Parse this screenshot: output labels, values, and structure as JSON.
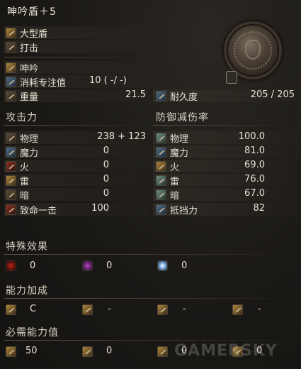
{
  "title": "呻吟盾＋5",
  "item_info": {
    "type": "大型盾",
    "attack_type": "打击",
    "skill": "呻吟",
    "fp_cost_label": "消耗专注值",
    "fp_cost_value": "10 (   -/   -)",
    "weight_label": "重量",
    "weight_value": "21.5",
    "durability_label": "耐久度",
    "durability_value": "205 /   205"
  },
  "attack": {
    "header": "攻击力",
    "rows": [
      {
        "label": "物理",
        "value": "238 +   123",
        "icon": "physical-attack-icon"
      },
      {
        "label": "魔力",
        "value": "0",
        "icon": "magic-attack-icon"
      },
      {
        "label": "火",
        "value": "0",
        "icon": "fire-attack-icon"
      },
      {
        "label": "雷",
        "value": "0",
        "icon": "lightning-attack-icon"
      },
      {
        "label": "暗",
        "value": "0",
        "icon": "dark-attack-icon"
      },
      {
        "label": "致命一击",
        "value": "100",
        "icon": "critical-icon"
      }
    ]
  },
  "defense": {
    "header": "防御减伤率",
    "rows": [
      {
        "label": "物理",
        "value": "100.0",
        "icon": "physical-defense-icon"
      },
      {
        "label": "魔力",
        "value": "81.0",
        "icon": "magic-defense-icon"
      },
      {
        "label": "火",
        "value": "69.0",
        "icon": "fire-defense-icon"
      },
      {
        "label": "雷",
        "value": "76.0",
        "icon": "lightning-defense-icon"
      },
      {
        "label": "暗",
        "value": "67.0",
        "icon": "dark-defense-icon"
      },
      {
        "label": "抵挡力",
        "value": "82",
        "icon": "stability-icon"
      }
    ]
  },
  "special_effects": {
    "header": "特殊效果",
    "items": [
      {
        "icon": "bleed-icon",
        "value": "0"
      },
      {
        "icon": "poison-icon",
        "value": "0"
      },
      {
        "icon": "frost-icon",
        "value": "0"
      }
    ]
  },
  "scaling": {
    "header": "能力加成",
    "items": [
      {
        "icon": "strength-icon",
        "value": "C"
      },
      {
        "icon": "dexterity-icon",
        "value": "-"
      },
      {
        "icon": "intelligence-icon",
        "value": "-"
      },
      {
        "icon": "faith-icon",
        "value": "-"
      }
    ]
  },
  "requirements": {
    "header": "必需能力值",
    "items": [
      {
        "icon": "strength-req-icon",
        "value": "50"
      },
      {
        "icon": "dexterity-req-icon",
        "value": "0"
      },
      {
        "icon": "intelligence-req-icon",
        "value": "0"
      },
      {
        "icon": "faith-req-icon",
        "value": "0"
      }
    ]
  },
  "watermark": "GAMERSKY",
  "colors": {
    "background": "#1a1815",
    "text": "#e6e0d2",
    "section_text": "#d9d2c2"
  }
}
